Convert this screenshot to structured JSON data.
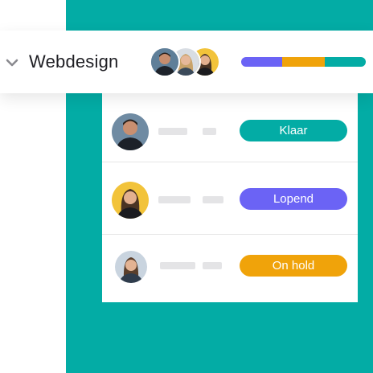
{
  "colors": {
    "teal": "#03aca5",
    "purple": "#6b63f5",
    "orange": "#f0a30a"
  },
  "group": {
    "title": "Webdesign",
    "collapse_icon": "chevron-down-icon",
    "progress": [
      {
        "status": "Lopend",
        "fraction": 0.33,
        "color": "#6b63f5"
      },
      {
        "status": "On hold",
        "fraction": 0.34,
        "color": "#f0a30a"
      },
      {
        "status": "Klaar",
        "fraction": 0.33,
        "color": "#03aca5"
      }
    ]
  },
  "tasks": [
    {
      "status": "Klaar",
      "color": "#03aca5"
    },
    {
      "status": "Lopend",
      "color": "#6b63f5"
    },
    {
      "status": "On hold",
      "color": "#f0a30a"
    }
  ]
}
